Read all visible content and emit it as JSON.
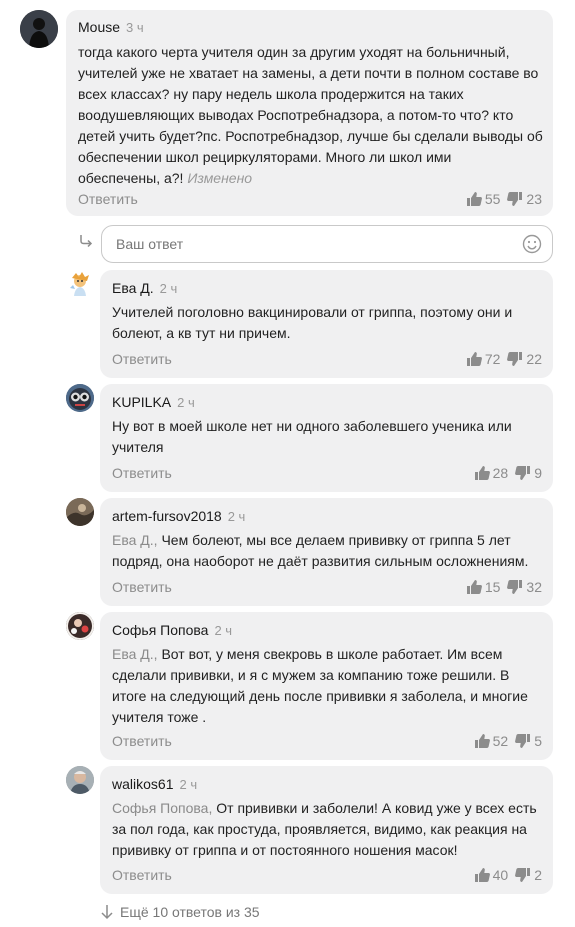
{
  "main_comment": {
    "author": "Mouse",
    "time": "3 ч",
    "lines": [
      "тогда какого черта учителя один за другим уходят на больничный,",
      "учителей уже не хватает на замены, а дети почти в полном составе во",
      "всех классах? ну пару недель школа продержится на таких",
      "воодушевляющих выводах Роспотребнадзора, а потом-то что? кто",
      "детей учить будет?пс. Роспотребнадзор, лучше бы сделали выводы об",
      "обеспечении школ рециркуляторами. Много ли школ ими",
      "обеспечены, а?!"
    ],
    "edited": "Изменено",
    "reply_label": "Ответить",
    "likes": "55",
    "dislikes": "23"
  },
  "reply_input": {
    "placeholder": "Ваш ответ"
  },
  "replies": [
    {
      "author": "Ева Д.",
      "time": "2 ч",
      "mention": "",
      "lines": [
        "Учителей поголовно вакцинировали от гриппа, поэтому они и",
        "болеют, а кв тут ни причем."
      ],
      "reply_label": "Ответить",
      "likes": "72",
      "dislikes": "22"
    },
    {
      "author": "KUPILKA",
      "time": "2 ч",
      "mention": "",
      "lines": [
        "Ну вот в моей школе нет ни одного заболевшего ученика или",
        "учителя"
      ],
      "reply_label": "Ответить",
      "likes": "28",
      "dislikes": "9"
    },
    {
      "author": "artem-fursov2018",
      "time": "2 ч",
      "mention": "Ева Д.,",
      "lines": [
        " Чем болеют, мы все делаем прививку от гриппа 5 лет",
        "подряд, она наоборот не даёт развития сильным осложнениям."
      ],
      "reply_label": "Ответить",
      "likes": "15",
      "dislikes": "32"
    },
    {
      "author": "Софья Попова",
      "time": "2 ч",
      "mention": "Ева Д.,",
      "lines": [
        " Вот вот, у меня свекровь в школе работает. Им всем",
        "сделали прививки, и я с мужем за компанию тоже решили. В",
        "итоге на следующий день после прививки я заболела, и многие",
        "учителя тоже ."
      ],
      "reply_label": "Ответить",
      "likes": "52",
      "dislikes": "5"
    },
    {
      "author": "walikos61",
      "time": "2 ч",
      "mention": "Софья Попова,",
      "lines": [
        " От прививки и заболели! А ковид уже у всех есть",
        "за пол года, как простуда, проявляется,  видимо, как реакция на",
        "прививку от гриппа и от постоянного ношения масок!"
      ],
      "reply_label": "Ответить",
      "likes": "40",
      "dislikes": "2"
    }
  ],
  "more_replies": "Ещё 10 ответов из 35",
  "icons": {
    "like": "thumbs-up-icon",
    "dislike": "thumbs-down-icon",
    "smile": "smile-icon",
    "reply_arrow": "reply-arrow-icon",
    "more": "arrow-down-icon"
  },
  "colors": {
    "bubble": "#f0f0f1",
    "muted": "#8c8c8c",
    "text": "#222222"
  }
}
